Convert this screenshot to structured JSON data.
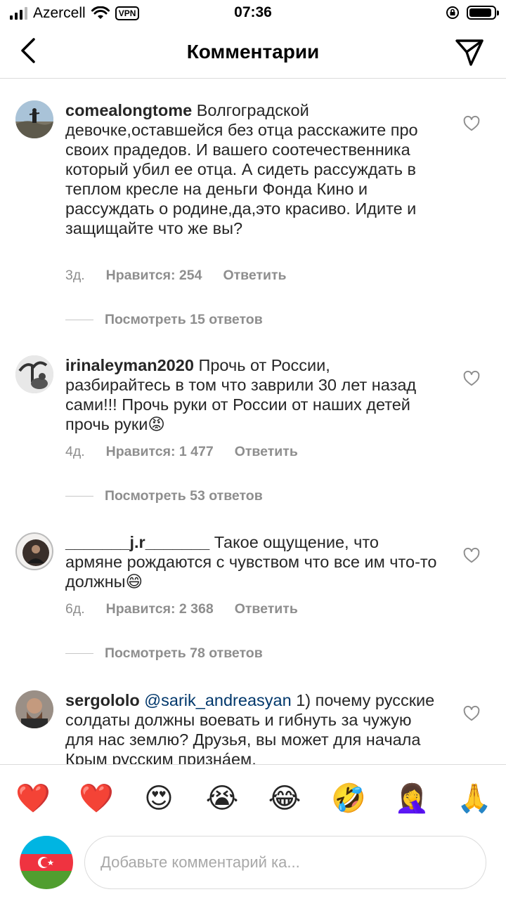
{
  "status_bar": {
    "carrier": "Azercell",
    "vpn": "VPN",
    "time": "07:36"
  },
  "header": {
    "title": "Комментарии",
    "back_icon": "chevron-left-icon",
    "send_icon": "paper-plane-icon"
  },
  "comments": [
    {
      "username": "comealongtome",
      "text": "Волгоградской девочке,оставшейся без отца расскажите про своих прадедов. И вашего соотечественника который убил ее отца. А сидеть рассуждать в теплом кресле на деньги Фонда Кино и рассуждать о родине,да,это красиво. Идите и защищайте что же вы?",
      "age": "3д.",
      "likes": "Нравится: 254",
      "reply": "Ответить",
      "view_replies": "Посмотреть 15 ответов"
    },
    {
      "username": "irinaleyman2020",
      "text": "Прочь от России, разбирайтесь в том что заврили 30 лет назад сами!!! Прочь руки от России от наших детей прочь руки😡",
      "age": "4д.",
      "likes": "Нравится: 1 477",
      "reply": "Ответить",
      "view_replies": "Посмотреть 53 ответов"
    },
    {
      "username": "_______j.r_______",
      "text": "Такое ощущение, что армяне рождаются с чувством что все им что-то должны😄",
      "age": "6д.",
      "likes": "Нравится: 2 368",
      "reply": "Ответить",
      "view_replies": "Посмотреть 78 ответов"
    },
    {
      "username": "sergololo",
      "mention": "@sarik_andreasyan",
      "text": "1) почему русские солдаты должны воевать и гибнуть за чужую для нас землю? Друзья, вы может для начала Крым русским признáем,"
    }
  ],
  "emoji_bar": [
    "❤️",
    "❤️",
    "😍",
    "😭",
    "😂",
    "🤣",
    "🤦‍♀️",
    "🙏"
  ],
  "input": {
    "placeholder": "Добавьте комментарий ка..."
  }
}
